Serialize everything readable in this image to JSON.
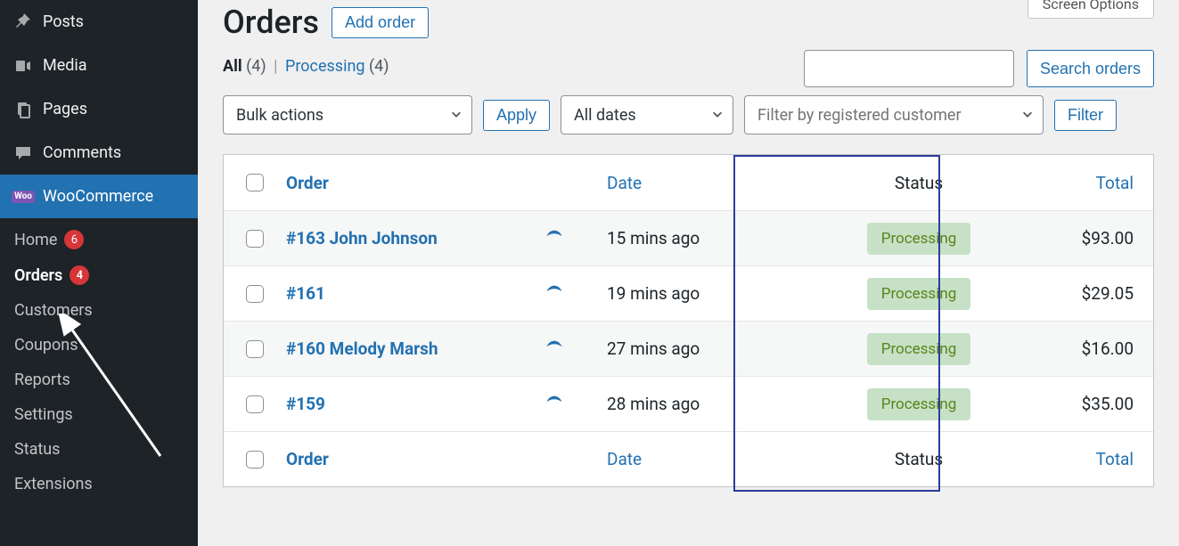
{
  "screen_options_label": "Screen Options",
  "sidebar": {
    "items": [
      {
        "label": "Posts"
      },
      {
        "label": "Media"
      },
      {
        "label": "Pages"
      },
      {
        "label": "Comments"
      },
      {
        "label": "WooCommerce"
      }
    ],
    "submenu": [
      {
        "label": "Home",
        "badge": "6"
      },
      {
        "label": "Orders",
        "badge": "4"
      },
      {
        "label": "Customers"
      },
      {
        "label": "Coupons"
      },
      {
        "label": "Reports"
      },
      {
        "label": "Settings"
      },
      {
        "label": "Status"
      },
      {
        "label": "Extensions"
      }
    ]
  },
  "header": {
    "title": "Orders",
    "add_button": "Add order"
  },
  "filters": {
    "all_label": "All",
    "all_count": "(4)",
    "separator": "|",
    "processing_label": "Processing",
    "processing_count": "(4)"
  },
  "search": {
    "button": "Search orders"
  },
  "controls": {
    "bulk_actions": "Bulk actions",
    "apply": "Apply",
    "all_dates": "All dates",
    "customer_filter_placeholder": "Filter by registered customer",
    "filter": "Filter"
  },
  "table": {
    "headers": {
      "order": "Order",
      "date": "Date",
      "status": "Status",
      "total": "Total"
    },
    "rows": [
      {
        "order": "#163 John Johnson",
        "date": "15 mins ago",
        "status": "Processing",
        "total": "$93.00"
      },
      {
        "order": "#161",
        "date": "19 mins ago",
        "status": "Processing",
        "total": "$29.05"
      },
      {
        "order": "#160 Melody Marsh",
        "date": "27 mins ago",
        "status": "Processing",
        "total": "$16.00"
      },
      {
        "order": "#159",
        "date": "28 mins ago",
        "status": "Processing",
        "total": "$35.00"
      }
    ]
  }
}
